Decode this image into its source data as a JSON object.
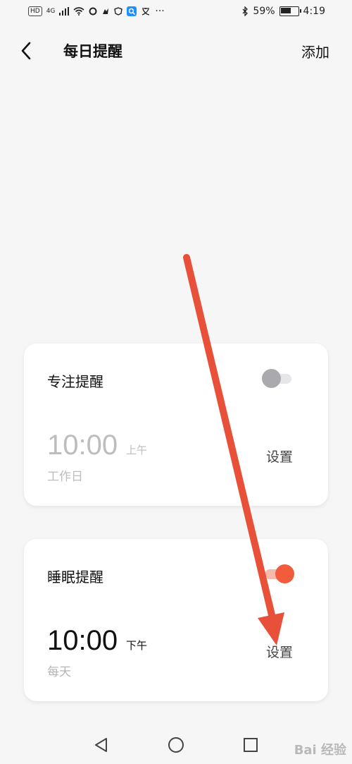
{
  "status_bar": {
    "hd": "HD",
    "network": "4G",
    "more": "···",
    "battery_text": "59%",
    "battery_level": 0.59,
    "time": "4:19"
  },
  "header": {
    "title": "每日提醒",
    "add_label": "添加"
  },
  "reminders": [
    {
      "title": "专注提醒",
      "time": "10:00",
      "ampm": "上午",
      "repeat": "工作日",
      "set_label": "设置",
      "enabled": false
    },
    {
      "title": "睡眠提醒",
      "time": "10:00",
      "ampm": "下午",
      "repeat": "每天",
      "set_label": "设置",
      "enabled": true
    }
  ],
  "colors": {
    "accent": "#f25c3d",
    "toggle_off_knob": "#a9a9ae",
    "toggle_off_track": "#e6e6e8",
    "toggle_on_track": "#f7b9aa",
    "annotation_arrow": "#e8503a"
  },
  "navbar": {
    "icons": [
      "back-triangle-icon",
      "home-circle-icon",
      "recents-square-icon"
    ]
  },
  "watermark": {
    "text": "Bai 经验"
  }
}
